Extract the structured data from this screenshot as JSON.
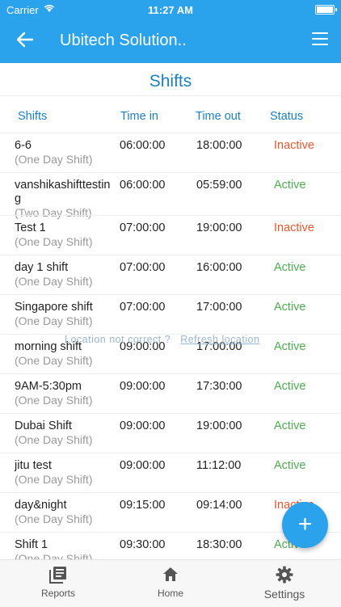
{
  "status_bar": {
    "carrier": "Carrier",
    "time": "11:27 AM"
  },
  "app_bar": {
    "title": "Ubitech Solution.."
  },
  "page": {
    "heading": "Shifts"
  },
  "table": {
    "headers": {
      "shifts": "Shifts",
      "time_in": "Time in",
      "time_out": "Time out",
      "status": "Status"
    },
    "rows": [
      {
        "name": "6-6",
        "type": "(One Day Shift)",
        "time_in": "06:00:00",
        "time_out": "18:00:00",
        "status": "Inactive"
      },
      {
        "name": "vanshikashifttesting",
        "type": "(Two Day Shift)",
        "time_in": "06:00:00",
        "time_out": "05:59:00",
        "status": "Active"
      },
      {
        "name": "Test 1",
        "type": "(One Day Shift)",
        "time_in": "07:00:00",
        "time_out": "19:00:00",
        "status": "Inactive"
      },
      {
        "name": "day 1 shift",
        "type": "(One Day Shift)",
        "time_in": "07:00:00",
        "time_out": "16:00:00",
        "status": "Active"
      },
      {
        "name": "Singapore shift",
        "type": "(One Day Shift)",
        "time_in": "07:00:00",
        "time_out": "17:00:00",
        "status": "Active"
      },
      {
        "name": "morning shift",
        "type": "(One Day Shift)",
        "time_in": "09:00:00",
        "time_out": "17:00:00",
        "status": "Active"
      },
      {
        "name": "9AM-5:30pm",
        "type": "(One Day Shift)",
        "time_in": "09:00:00",
        "time_out": "17:30:00",
        "status": "Active"
      },
      {
        "name": "Dubai Shift",
        "type": "(One Day Shift)",
        "time_in": "09:00:00",
        "time_out": "19:00:00",
        "status": "Active"
      },
      {
        "name": "jitu test",
        "type": "(One Day Shift)",
        "time_in": "09:00:00",
        "time_out": "11:12:00",
        "status": "Active"
      },
      {
        "name": "day&night",
        "type": "(One Day Shift)",
        "time_in": "09:15:00",
        "time_out": "09:14:00",
        "status": "Inactive"
      },
      {
        "name": "Shift 1",
        "type": "(One Day Shift)",
        "time_in": "09:30:00",
        "time_out": "18:30:00",
        "status": "Active"
      }
    ]
  },
  "location_message": {
    "text": "Location not correct ?",
    "link": "Refresh location"
  },
  "fab": {
    "icon": "plus-icon",
    "label": "+"
  },
  "bottom_nav": {
    "items": [
      {
        "label": "Reports",
        "icon": "reports-icon"
      },
      {
        "label": "Home",
        "icon": "home-icon"
      },
      {
        "label": "Settings",
        "icon": "gear-icon"
      }
    ]
  },
  "colors": {
    "primary": "#2aa3ec",
    "accent_text": "#1c7fc4",
    "active": "#4cae4f",
    "inactive": "#e8572e"
  }
}
